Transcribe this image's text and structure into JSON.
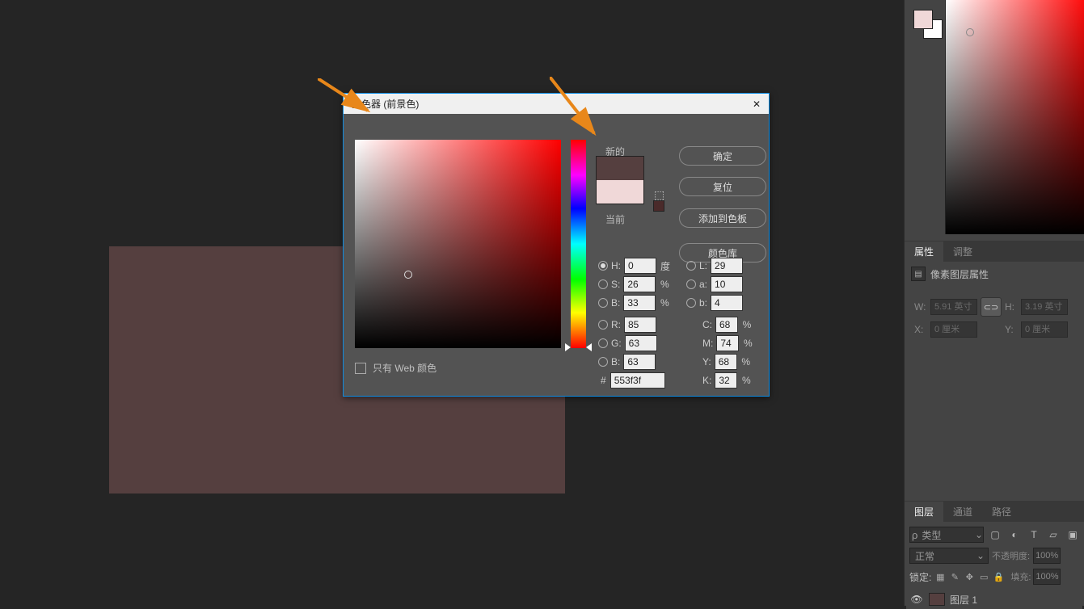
{
  "canvas": {
    "fill_color": "#553f3f"
  },
  "dialog": {
    "title": "拾色器 (前景色)",
    "new_label": "新的",
    "current_label": "当前",
    "ok": "确定",
    "cancel": "复位",
    "add": "添加到色板",
    "lib": "颜色库",
    "web_only": "只有 Web 颜色",
    "hue_degree_unit": "度",
    "percent": "%",
    "labels": {
      "H": "H:",
      "S": "S:",
      "B": "B:",
      "R": "R:",
      "G": "G:",
      "Bch": "B:",
      "L": "L:",
      "a": "a:",
      "b": "b:",
      "C": "C:",
      "M": "M:",
      "Y": "Y:",
      "K": "K:"
    },
    "hex_prefix": "#",
    "values": {
      "H": "0",
      "S": "26",
      "V": "33",
      "R": "85",
      "G": "63",
      "Bch": "63",
      "L": "29",
      "a": "10",
      "bl": "4",
      "C": "68",
      "M": "74",
      "Y": "68",
      "K": "32",
      "hex": "553f3f"
    },
    "new_color": "#553f3f",
    "current_color": "#f0d8d8"
  },
  "right": {
    "tabs_props": {
      "props": "属性",
      "adjust": "调整"
    },
    "pixel_props_label": "像素图层属性",
    "dims": {
      "W_label": "W:",
      "W": "5.91 英寸",
      "H_label": "H:",
      "H": "3.19 英寸",
      "X_label": "X:",
      "X": "0 厘米",
      "Y_label": "Y:",
      "Y": "0 厘米"
    },
    "tabs_layers": {
      "layers": "图层",
      "channels": "通道",
      "paths": "路径"
    },
    "type_select": "类型",
    "blend_mode": "正常",
    "opacity_label": "不透明度:",
    "opacity": "100%",
    "lock_label": "锁定:",
    "fill_label": "填充:",
    "fill": "100%",
    "layer_name": "图层 1",
    "search_placeholder": "ρ"
  }
}
